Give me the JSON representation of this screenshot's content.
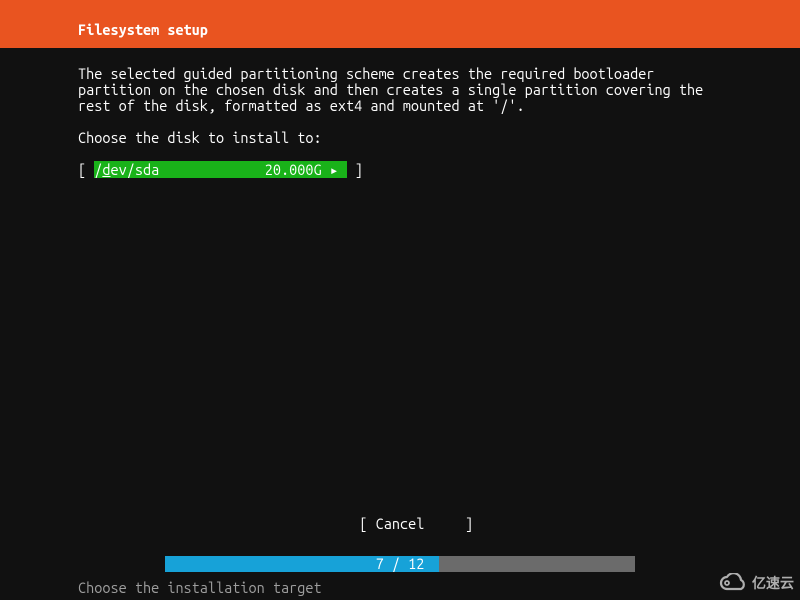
{
  "header": {
    "title": "Filesystem setup"
  },
  "body": {
    "description": "The selected guided partitioning scheme creates the required bootloader\npartition on the chosen disk and then creates a single partition covering the\nrest of the disk, formatted as ext4 and mounted at '/'.",
    "prompt": "Choose the disk to install to:",
    "disk": {
      "open_bracket": "[ ",
      "prefix": "/",
      "hotkey": "d",
      "rest_name": "ev/sda",
      "size": "20.000G",
      "arrow": "▸",
      "close_bracket": " ]"
    }
  },
  "footer": {
    "cancel": "[ Cancel     ]",
    "progress": {
      "current": 7,
      "total": 12,
      "label": "7 / 12"
    },
    "hint": "Choose the installation target"
  },
  "watermark": {
    "text": "亿速云"
  },
  "colors": {
    "accent": "#e95420",
    "select_bg": "#19b219",
    "progress_fill": "#17a2d8",
    "progress_bg": "#6b6b6b"
  }
}
